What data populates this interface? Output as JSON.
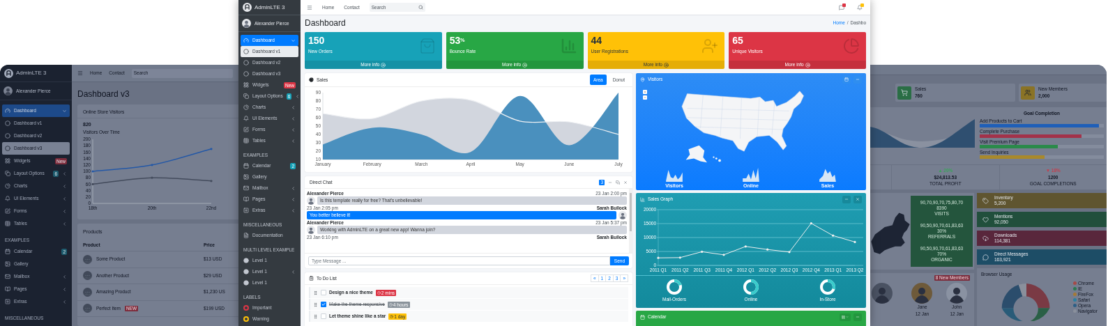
{
  "back_left": {
    "brand": "AdminLTE 3",
    "user": "Alexander Pierce",
    "sidebar": [
      {
        "kind": "item",
        "label": "Dashboard",
        "selected": true,
        "expanded": true
      },
      {
        "kind": "sub",
        "label": "Dashboard v1",
        "selected": false
      },
      {
        "kind": "sub",
        "label": "Dashboard v2",
        "selected": false
      },
      {
        "kind": "sub",
        "label": "Dashboard v3",
        "selected": true
      },
      {
        "kind": "item",
        "label": "Widgets",
        "selected": false,
        "badge": {
          "text": "New",
          "color": "#7d2c3c"
        }
      },
      {
        "kind": "item",
        "label": "Layout Options",
        "selected": false,
        "badge": {
          "text": "6",
          "color": "#1d5b6e"
        },
        "expanded": false
      },
      {
        "kind": "item",
        "label": "Charts",
        "selected": false,
        "expanded": false
      },
      {
        "kind": "item",
        "label": "UI Elements",
        "selected": false,
        "expanded": false
      },
      {
        "kind": "item",
        "label": "Forms",
        "selected": false,
        "expanded": false
      },
      {
        "kind": "item",
        "label": "Tables",
        "selected": false,
        "expanded": false
      },
      {
        "kind": "header",
        "label": "EXAMPLES"
      },
      {
        "kind": "item",
        "label": "Calendar",
        "selected": false,
        "badge": {
          "text": "2",
          "color": "#1d5b6e"
        }
      },
      {
        "kind": "item",
        "label": "Gallery",
        "selected": false
      },
      {
        "kind": "item",
        "label": "Mailbox",
        "selected": false,
        "expanded": false
      },
      {
        "kind": "item",
        "label": "Pages",
        "selected": false,
        "expanded": false
      },
      {
        "kind": "item",
        "label": "Extras",
        "selected": false,
        "expanded": false
      },
      {
        "kind": "header",
        "label": "MISCELLANEOUS"
      }
    ],
    "navbar": {
      "links": [
        "Home",
        "Contact"
      ],
      "search": {
        "placeholder": "Search"
      }
    },
    "page_title": "Dashboard v3",
    "visitors_card": {
      "title": "Online Store Visitors",
      "total": "820",
      "caption": "Visitors Over Time",
      "chart_data": {
        "type": "line",
        "categories": [
          "18th",
          "20th",
          "22nd"
        ],
        "ylim": [
          0,
          200
        ],
        "yticks": [
          0,
          20,
          40,
          60,
          80,
          100,
          120,
          140,
          160,
          180,
          200
        ],
        "series": [
          {
            "color": "#2458a6",
            "values": [
              100,
              120,
              170
            ]
          },
          {
            "color": "#434b5c",
            "values": [
              60,
              80,
              70
            ]
          }
        ]
      }
    },
    "products": {
      "title": "Products",
      "columns": [
        "Product",
        "Price"
      ],
      "rows": [
        {
          "name": "Some Product",
          "price": "$13 USD"
        },
        {
          "name": "Another Product",
          "price": "$29 USD"
        },
        {
          "name": "Amazing Product",
          "price": "$1,230 US"
        },
        {
          "name": "Perfect Item",
          "badge": "NEW",
          "price": "$199 USD"
        }
      ]
    }
  },
  "front": {
    "brand": "AdminLTE 3",
    "user": "Alexander Pierce",
    "sidebar": [
      {
        "kind": "item",
        "label": "Dashboard",
        "selected": true,
        "expanded": true
      },
      {
        "kind": "sub",
        "label": "Dashboard v1",
        "selected": true
      },
      {
        "kind": "sub",
        "label": "Dashboard v2",
        "selected": false
      },
      {
        "kind": "sub",
        "label": "Dashboard v3",
        "selected": false
      },
      {
        "kind": "item",
        "label": "Widgets",
        "selected": false,
        "badge": {
          "text": "New",
          "color": "#dc3545"
        }
      },
      {
        "kind": "item",
        "label": "Layout Options",
        "selected": false,
        "badge": {
          "text": "6",
          "color": "#17a2b8"
        },
        "expanded": false
      },
      {
        "kind": "item",
        "label": "Charts",
        "selected": false,
        "expanded": false
      },
      {
        "kind": "item",
        "label": "UI Elements",
        "selected": false,
        "expanded": false
      },
      {
        "kind": "item",
        "label": "Forms",
        "selected": false,
        "expanded": false
      },
      {
        "kind": "item",
        "label": "Tables",
        "selected": false,
        "expanded": false
      },
      {
        "kind": "header",
        "label": "EXAMPLES"
      },
      {
        "kind": "item",
        "label": "Calendar",
        "selected": false,
        "badge": {
          "text": "2",
          "color": "#17a2b8"
        }
      },
      {
        "kind": "item",
        "label": "Gallery",
        "selected": false
      },
      {
        "kind": "item",
        "label": "Mailbox",
        "selected": false,
        "expanded": false
      },
      {
        "kind": "item",
        "label": "Pages",
        "selected": false,
        "expanded": false
      },
      {
        "kind": "item",
        "label": "Extras",
        "selected": false,
        "expanded": false
      },
      {
        "kind": "header",
        "label": "MISCELLANEOUS"
      },
      {
        "kind": "item",
        "label": "Documentation",
        "selected": false
      },
      {
        "kind": "header",
        "label": "MULTI LEVEL EXAMPLE"
      },
      {
        "kind": "bullet",
        "label": "Level 1",
        "selected": false
      },
      {
        "kind": "bullet",
        "label": "Level 1",
        "selected": false,
        "expanded": false
      },
      {
        "kind": "bullet",
        "label": "Level 1",
        "selected": false
      },
      {
        "kind": "header",
        "label": "LABELS"
      },
      {
        "kind": "label",
        "label": "Important",
        "selected": false,
        "color": "#dc3545"
      },
      {
        "kind": "label",
        "label": "Warning",
        "selected": false,
        "color": "#ffc107"
      }
    ],
    "navbar": {
      "links": [
        "Home",
        "Contact"
      ],
      "search": {
        "placeholder": "Search"
      },
      "notifications": [
        {
          "color": "#dc3545"
        },
        {
          "color": "#ffc107"
        }
      ]
    },
    "page_title": "Dashboard",
    "breadcrumb": {
      "home": "Home",
      "separator": "/",
      "current": "Dashbo"
    },
    "small_boxes": [
      {
        "value": "150",
        "label": "New Orders",
        "color": "#17a2b8",
        "footer": "More info"
      },
      {
        "value": "53$^{%}$",
        "label": "Bounce Rate",
        "color": "#28a745",
        "footer": "More info"
      },
      {
        "value": "44",
        "label": "User Registrations",
        "color": "#ffc107",
        "footer": "More info"
      },
      {
        "value": "65",
        "label": "Unique Visitors",
        "color": "#dc3545",
        "footer": "More info"
      }
    ],
    "sales": {
      "title": "Sales",
      "tabs": [
        {
          "label": "Area",
          "selected": true
        },
        {
          "label": "Donut",
          "selected": false
        }
      ],
      "chart_data": {
        "type": "area",
        "categories": [
          "January",
          "February",
          "March",
          "April",
          "May",
          "June",
          "July"
        ],
        "ylim": [
          10,
          90
        ],
        "yticks": [
          10,
          20,
          30,
          40,
          50,
          60,
          70,
          80,
          90
        ],
        "series": [
          {
            "color": "#d2d6de",
            "values": [
              65,
              59,
              80,
              81,
              56,
              55,
              40
            ]
          },
          {
            "color": "#4a90be",
            "values": [
              28,
              48,
              40,
              19,
              86,
              27,
              90
            ]
          }
        ]
      }
    },
    "direct_chat": {
      "title": "Direct Chat",
      "badge": "3",
      "messages": [
        {
          "kind": "received",
          "name": "Alexander Pierce",
          "time": "23 Jan 2:00 pm",
          "text": "Is this template really for free? That's unbelievable!"
        },
        {
          "kind": "sent",
          "name": "Sarah Bullock",
          "time": "23 Jan 2:05 pm",
          "text": "You better believe it!"
        },
        {
          "kind": "received",
          "name": "Alexander Pierce",
          "time": "23 Jan 5:37 pm",
          "text": "Working with AdminLTE on a great new app! Wanna join?"
        },
        {
          "kind": "sent",
          "name": "Sarah Bullock",
          "time": "23 Jan 6:10 pm"
        }
      ],
      "input": {
        "placeholder": "Type Message ..."
      },
      "send": "Send"
    },
    "todo": {
      "title": "To Do List",
      "pages": [
        "«",
        "1",
        "2",
        "3",
        "»"
      ],
      "items": [
        {
          "text": "Design a nice theme",
          "checked": false,
          "badge": {
            "text": "2 mins",
            "color": "#dc3545"
          }
        },
        {
          "text": "Make the theme responsive",
          "checked": true,
          "badge": {
            "text": "4 hours",
            "color": "#8a939b"
          }
        },
        {
          "text": "Let theme shine like a star",
          "checked": false,
          "badge": {
            "text": "1 day",
            "color": "#ffc107"
          }
        }
      ]
    },
    "visitors": {
      "title": "Visitors",
      "stats": [
        "Visitors",
        "Online",
        "Sales"
      ]
    },
    "sales_graph": {
      "title": "Sales Graph",
      "chart_data": {
        "type": "line",
        "categories": [
          "2011 Q1",
          "2011 Q2",
          "2011 Q3",
          "2011 Q4",
          "2012 Q1",
          "2012 Q2",
          "2012 Q3",
          "2012 Q4",
          "2013 Q1",
          "2013 Q2"
        ],
        "ylim": [
          0,
          20000
        ],
        "yticks": [
          0,
          5000,
          10000,
          15000,
          20000
        ],
        "grid": true,
        "series": [
          {
            "color": "#efefef",
            "values": [
              2700,
              2800,
              4900,
              3800,
              6800,
              5700,
              4800,
              15100,
              10700,
              8400
            ]
          }
        ]
      },
      "knobs": [
        {
          "label": "Mail-Orders",
          "level": 0.2
        },
        {
          "label": "Online",
          "level": 0.5
        },
        {
          "label": "In-Store",
          "level": 0.3
        }
      ]
    },
    "calendar": {
      "title": "Calendar"
    }
  },
  "back_right": {
    "info_boxes": [
      {
        "label": "Sales",
        "value": "760",
        "color": "#2a6e45"
      },
      {
        "label": "New Members",
        "value": "2,000",
        "color": "#8a7326"
      }
    ],
    "goal": {
      "title": "Goal Completion",
      "bars": [
        {
          "label": "Add Products to Cart",
          "level": 0.96,
          "color": "#1f5fb8"
        },
        {
          "label": "Complete Purchase",
          "level": 0.82,
          "color": "#a3324a"
        },
        {
          "label": "Visit Premium Page",
          "level": 0.63,
          "color": "#2a8a4a"
        },
        {
          "label": "Send Inquiries",
          "level": 0.52,
          "color": "#a8892c"
        }
      ]
    },
    "stats": [
      {
        "change": "▲ 20%",
        "color": "#3aa35a",
        "value": "$24,813.53",
        "label": "TOTAL PROFIT"
      },
      {
        "change": "▼ 18%",
        "color": "#c2404f",
        "value": "1200",
        "label": "GOAL COMPLETIONS"
      }
    ],
    "map_stats": [
      {
        "spark": "90,70,90,70,75,80,70",
        "value": "8390",
        "label": "VISITS"
      },
      {
        "spark": "90,50,90,70,61,83,63",
        "value": "30%",
        "label": "REFERRALS"
      },
      {
        "spark": "90,50,90,70,61,83,63",
        "value": "70%",
        "label": "ORGANIC"
      }
    ],
    "counters": [
      {
        "label": "Inventory",
        "value": "5,200",
        "color": "#5f5530"
      },
      {
        "label": "Mentions",
        "value": "92,050",
        "color": "#214f3c"
      },
      {
        "label": "Downloads",
        "value": "114,381",
        "color": "#59273c"
      },
      {
        "label": "Direct Messages",
        "value": "163,921",
        "color": "#1d4d66"
      }
    ],
    "members": {
      "badge": "8 New Members",
      "people": [
        {
          "name": "Jane",
          "date": "12 Jan"
        },
        {
          "name": "John",
          "date": "12 Jan"
        }
      ]
    },
    "browser_usage": {
      "title": "Browser Usage",
      "legend": [
        {
          "label": "Chrome",
          "color": "#a54b48"
        },
        {
          "label": "IE",
          "color": "#2a7a50"
        },
        {
          "label": "FireFox",
          "color": "#a57a36"
        },
        {
          "label": "Safari",
          "color": "#2b7fa0"
        },
        {
          "label": "Opera",
          "color": "#2d5f86"
        },
        {
          "label": "Navigator",
          "color": "#8a909c"
        }
      ]
    }
  }
}
